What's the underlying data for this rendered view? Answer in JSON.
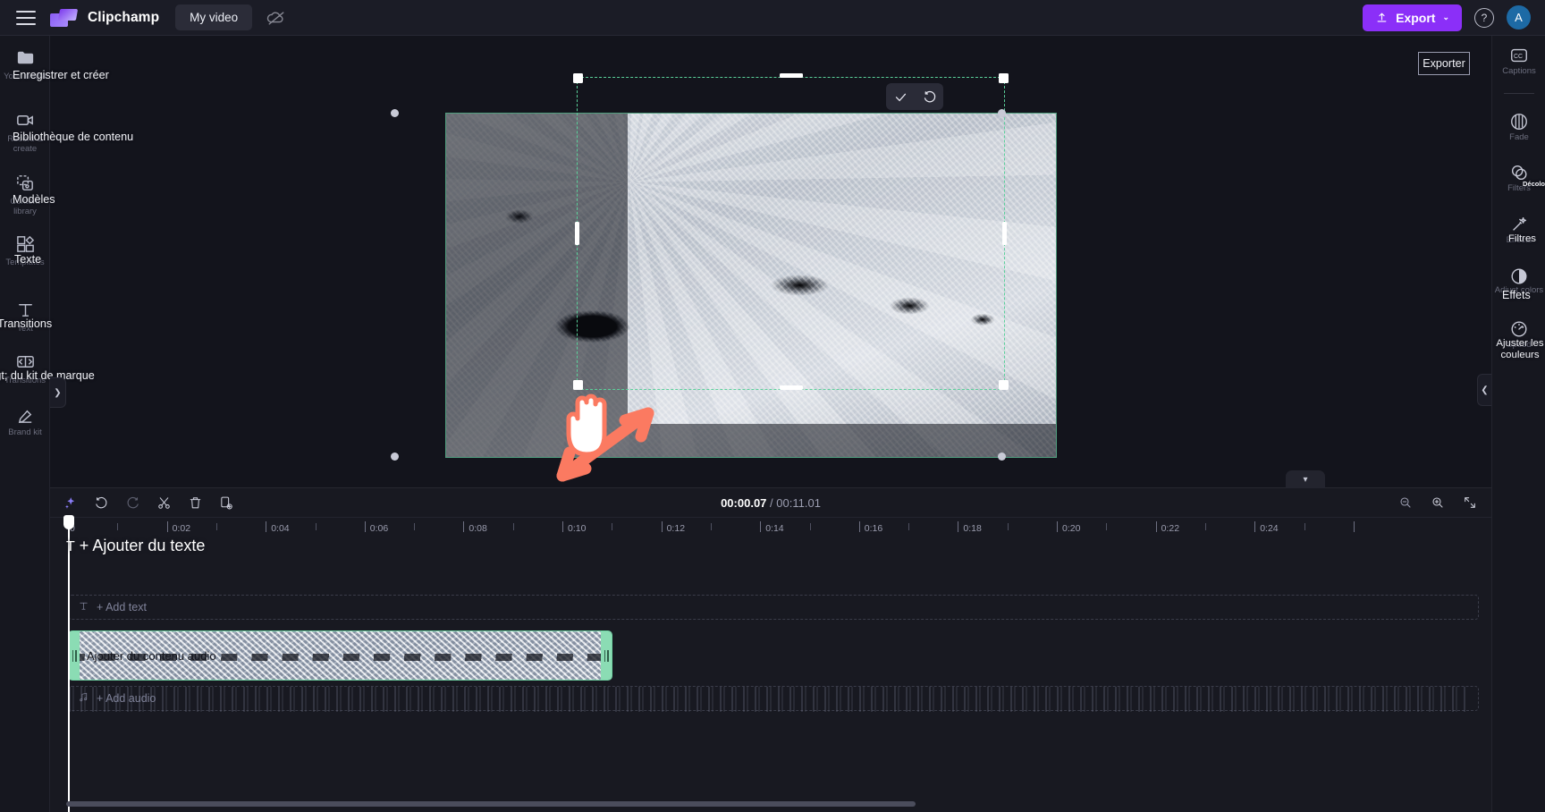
{
  "app": {
    "brand": "Clipchamp",
    "project_name": "My video",
    "menu_icon": "hamburger-icon",
    "cloud_icon": "cloud-off-icon"
  },
  "topbar": {
    "export_label": "Export",
    "export_caret": "⌄",
    "export_color": "#8b2ff8",
    "help_label": "?",
    "avatar_initial": "A"
  },
  "left_rail": {
    "items": [
      {
        "en": "Your media",
        "fr": "Enregistrer et créer",
        "icon": "folder-icon"
      },
      {
        "en": "Record & create",
        "fr": "Bibliothèque de contenu",
        "icon": "camera-icon"
      },
      {
        "en": "Content library",
        "fr": "Modèles",
        "icon": "content-library-icon"
      },
      {
        "en": "Templates",
        "fr": "Texte",
        "icon": "templates-icon"
      },
      {
        "en": "Text",
        "fr": "Transitions",
        "icon": "text-icon"
      },
      {
        "en": "Transitions",
        "fr": "&gt; du kit de marque",
        "icon": "transitions-icon"
      },
      {
        "en": "Brand kit",
        "fr": "",
        "icon": "brand-kit-icon"
      }
    ],
    "collapse_icon": "chevron-right-icon"
  },
  "right_rail": {
    "exporter_ghost_label": "Exporter",
    "items": [
      {
        "en": "Captions",
        "fr": "",
        "icon": "captions-icon"
      },
      {
        "en": "Fade",
        "fr": "",
        "icon": "fade-icon"
      },
      {
        "en": "Filters",
        "fr": "Décolorer",
        "icon": "filters-icon"
      },
      {
        "en": "Effects",
        "fr": "Filtres",
        "icon": "effects-icon"
      },
      {
        "en": "Adjust colors",
        "fr": "Effets",
        "icon": "adjust-colors-icon"
      },
      {
        "en": "Speed",
        "fr": "Ajuster les couleurs",
        "icon": "speed-icon"
      }
    ],
    "collapse_icon": "chevron-left-icon"
  },
  "crop_toolbar": {
    "confirm_icon": "check-icon",
    "reset_icon": "undo-icon"
  },
  "preview": {
    "crop_border_color": "#5ad19a",
    "cc_icon": "captions-off-icon",
    "fullscreen_icon": "fullscreen-icon",
    "controls": [
      {
        "name": "skip-to-start-button",
        "icon": "skip-start-icon"
      },
      {
        "name": "rewind-5-button",
        "icon": "rewind-5-icon"
      },
      {
        "name": "play-button",
        "icon": "play-icon"
      },
      {
        "name": "forward-5-button",
        "icon": "forward-5-icon"
      },
      {
        "name": "skip-to-end-button",
        "icon": "skip-end-icon"
      }
    ]
  },
  "timeline": {
    "current_time": "00:00.07",
    "separator": "/",
    "total_time": "00:11.01",
    "toolbar": [
      {
        "name": "magic-tools-button",
        "icon": "sparkle-icon"
      },
      {
        "name": "undo-button",
        "icon": "undo-icon"
      },
      {
        "name": "redo-button",
        "icon": "redo-icon"
      },
      {
        "name": "split-button",
        "icon": "scissors-icon"
      },
      {
        "name": "delete-button",
        "icon": "trash-icon"
      },
      {
        "name": "duplicate-button",
        "icon": "duplicate-icon"
      }
    ],
    "zoom_out_icon": "zoom-out-icon",
    "zoom_in_icon": "zoom-in-icon",
    "fit_icon": "fit-to-screen-icon",
    "collapse_icon": "chevron-down-icon",
    "ruler": {
      "start_label": "0",
      "labels": [
        "0:02",
        "0:04",
        "0:06",
        "0:08",
        "0:10",
        "0:12",
        "0:14",
        "0:16",
        "0:18",
        "0:20",
        "0:22",
        "0:24"
      ],
      "seconds_per_label": 2,
      "pixels_per_second": 55.3,
      "tick_interval_seconds": 1
    },
    "overlay_text_label": "+ Ajouter du texte",
    "overlay_text_icon": "text-icon",
    "tracks": [
      {
        "name": "add-text-track",
        "placeholder": "+ Add text",
        "icon": "text-icon",
        "type": "ghost"
      },
      {
        "name": "video-clip",
        "label": "Ajouter du contenu audio",
        "type": "clip",
        "start_seconds": 0,
        "duration_seconds": 11.01,
        "selected": true,
        "accent": "#6fd3a3"
      },
      {
        "name": "add-audio-track",
        "placeholder": "+ Add audio",
        "icon": "music-note-icon",
        "type": "ghost"
      }
    ],
    "playhead_seconds": 0.07
  },
  "annotations": {
    "cursor_icon": "pointing-hand-cursor",
    "arrow_icon": "arrow-annotation",
    "arrow_color": "#fb7a61"
  }
}
